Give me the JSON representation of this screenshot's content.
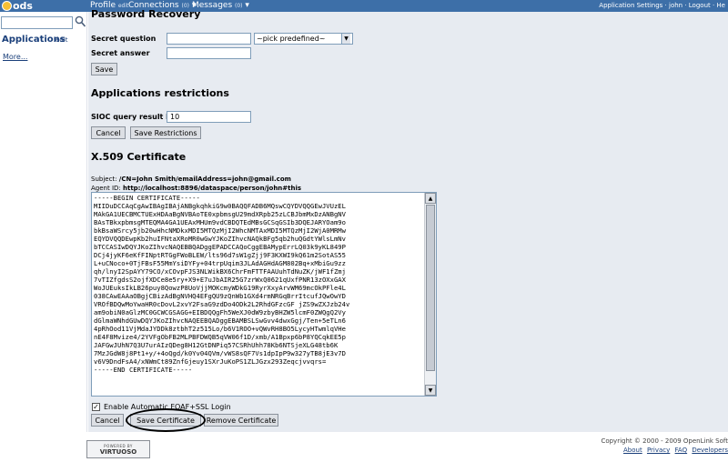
{
  "topbar": {
    "logo_text": "ods",
    "profile_label": "Profile",
    "profile_edit": "edit",
    "connections_label": "Connections",
    "connections_count": "(0)",
    "messages_label": "Messages",
    "messages_count": "(0)",
    "right_links": "Application Settings · john · Logout · He"
  },
  "sidebar": {
    "search_value": "",
    "applications_label": "Applications",
    "applications_edit": "edit",
    "more_link": "More..."
  },
  "password_recovery": {
    "heading": "Password Recovery",
    "secret_question_label": "Secret question",
    "secret_question_value": "",
    "question_select_value": "~pick predefined~",
    "secret_answer_label": "Secret answer",
    "secret_answer_value": "",
    "save_label": "Save"
  },
  "app_restrictions": {
    "heading": "Applications restrictions",
    "sioc_label": "SIOC query result limit",
    "sioc_value": "10",
    "cancel_label": "Cancel",
    "save_label": "Save Restrictions"
  },
  "x509": {
    "heading": "X.509 Certificate",
    "subject_label": "Subject:",
    "subject_value": "/CN=John Smith/emailAddress=john@gmail.com",
    "agent_label": "Agent ID:",
    "agent_value": "http://localhost:8896/dataspace/person/john#this",
    "certificate_text": "-----BEGIN CERTIFICATE-----\nMIIDuDCCAqCgAwIBAgIBAjANBgkqhkiG9w0BAQQFADB6MQswCQYDVQQGEwJVUzEL\nMAkGA1UECBMCTUExHDAaBgNVBAoTE0xpbmsgU29mdXRpb25zLCBJbmMxDzANBgNV\nBAsTBkxpbmsgMTEQMA4GA1UEAxMHUm9vdCBDQTEdMBsGCSqGSIb3DQEJARYOam9o\nbkBsaWSrcy5jb20wHhcNMDkxMDI5MTQzMjI2WhcNMTAxMDI5MTQzMjI2WjA0MRMw\nEQYDVQQDEwpKb2huIFNtaXRoMR0wGwYJKoZIhvcNAQkBFg5qb2huQGdtYWlsLmNv\nbTCCASIwDQYJKoZIhvcNAQEBBQADggEPADCCAQoCggEBAMypErrLQ03k9yKL849P\nDCj4jyKF6eKfFINptRTGgFWoBLEW/lts96d7sW1gZjj9F3KXWI9kQ61m2SotAS55\nL+uCNoco+0TjFBsF55MmYsiDYFy+04trpUqim3JLAdAGHdAGM802Bq+xMbiGu9zz\nqh/lnyI2SpAYY79CO/xCOvpFJS3NLWikBX6ChrFmFTTFAAUuhTdNuZK/jWF1fZmj\n7vTIZfgdsS2ojfXDCe8e5ry+X9+E7uJbAIR25G7zrWxQ0621qUxfPNR13zOXxGAX\nWoJUEuksIkLB26puy8QowzP8UoVjjMOKcmyWDkG19RyrXxyArvWM69mcOkPFle4L\n038CAwEAAaOBgjCBizAdBgNVHQ4EFgQU9zQnWb1GXd4rmNRGqBrrItcufJQwOwYD\nVROfBDQwMoYwaHR0cDovL2xvY2FsaG9zdDo4ODk2L2RhdGFzcGF jZS9wZXJzb24v\nam9obiN0aGlzMC0GCWCGSAGG+EIBDQQgFh5WeXJ0dW9zbyBHZW5lcmF0ZWQgQ2Vy\ndGlmaWNhdGUwDQYJKoZIhvcNAQEEBQADggEBAMBSLSwGvv4dwxGgj/Ten+5eTLn6\n4pRhOod11VjMdaJYDDk8ztbhT2z515Lo/b6V1ROO+vQWvRH8BO5LycyHTwmlqVHe\nnE4F8Mvize4/2YVFgObFB2MLPBFDWQB5qVW06f1D/xmb/A1Bpxp6bP8YQCqkEE5p\nJAFGwJUhN7Q3U7urAIzQDeg8H12GtDNPiq57CSRhUhh78Kb6NTSjeXLG48tb6K\n7MzJGdW8j8Pt1+y/+4oQgd/k0Yv04QVm/vWS8sQF7Vs1dpIpP9w327yTB8jE3v7D\nv6V9DndFsA4/xNWmCt89ZnfGjeuy1SXrJuKoPS1ZLJGzx293Zeqcjvvqrs=\n-----END CERTIFICATE-----",
    "auto_login_label": "Enable Automatic FOAF+SSL Login",
    "auto_login_checked": "✓",
    "cancel_label": "Cancel",
    "save_label": "Save Certificate",
    "remove_label": "Remove Certificate"
  },
  "footer": {
    "badge_powered": "POWERED BY",
    "badge_name": "VIRTUOSO",
    "copyright": "Copyright © 2000 - 2009 OpenLink Soft",
    "links": [
      "About",
      "Privacy",
      "FAQ",
      "Developers"
    ]
  },
  "colors": {
    "topbar": "#3d6fa8",
    "main_bg": "#e7ebf1",
    "link": "#1a3f7a"
  }
}
